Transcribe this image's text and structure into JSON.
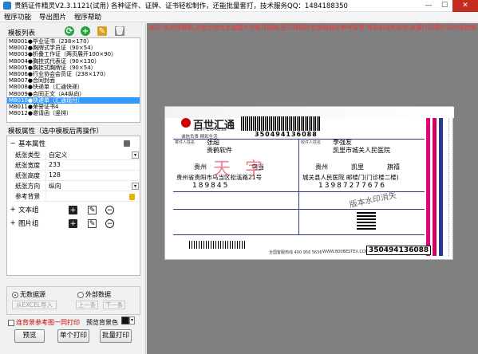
{
  "window": {
    "title": "贵鹤证件精灵V2.3.1121(试用)   各种证件、证牌、证书轻松制作，还能批量套打，技术服务QQ：1484188350"
  },
  "menu": [
    "程序功能",
    "导出图片",
    "程序帮助"
  ],
  "left": {
    "template_list_label": "模板列表",
    "templates": [
      "M8001●毕业证书（238×170）",
      "M8002●胸牌式学员证（90×54）",
      "M8003●折叠工作证（两页展开100×90）",
      "M8004●胸挂式代表证（90×130）",
      "M8005●胸挂式胸牌证（90×54）",
      "M8006●行业协会会员证（238×170）",
      "M8007●合同封面",
      "M8008●快递单（汇通快递）",
      "M8009●合同正文（A4纵向）",
      "M8010●快递单（汇通现付）",
      "M8011●荣誉证书4",
      "M8012●邀请函（竖排）"
    ],
    "selected_index": 9,
    "props_label": "模板属性（选中模板后再操作）",
    "groups": {
      "basic": "基本属性",
      "text": "文本组",
      "image": "图片组"
    },
    "props": [
      {
        "k": "纸张类型",
        "v": "自定义",
        "dd": true
      },
      {
        "k": "纸张宽度",
        "v": "233",
        "dd": false
      },
      {
        "k": "纸张高度",
        "v": "128",
        "dd": false
      },
      {
        "k": "纸张方向",
        "v": "纵向",
        "dd": true
      },
      {
        "k": "参考背景",
        "v": "",
        "dd": false
      }
    ],
    "radio_none": "无数据源",
    "radio_ext": "外部数据",
    "btn_excel": "从EXCEL导入",
    "btn_prev": "上一条",
    "btn_next": "下一条",
    "chk_bg": "连背景参考图一同打印",
    "preview_bg": "预览背景色",
    "btn_preview": "预览",
    "btn_single": "单个打印",
    "btn_batch": "批量打印"
  },
  "right": {
    "notice": "提示:先选择模板,双击左侧文本或图片对象可编辑,还可将图片直接拖放至参考背景.预览前请先核对,批量打印需打开外部数据."
  },
  "ticket": {
    "brand_cn": "百世汇通",
    "brand_en": "BEST EXPRESS",
    "slogan": "诚信负责·精彩生活",
    "tracking": "350494136088",
    "sender_label": "寄件人姓名",
    "sender_name": "张超",
    "sender_city": "贵州",
    "sender_district": "乌当",
    "sender_company": "贵鹤软件",
    "sender_address": "贵州省贵阳市乌当区松溪路21号",
    "sender_phone": "189845",
    "recipient_label": "收件人姓名",
    "recipient_name": "李强友",
    "recipient_city": "贵州",
    "recipient_district": "凯里",
    "recipient_area": "旗禧",
    "recipient_company": "凯里市城关人民医院",
    "recipient_address": "城关县人民医院 邮楼门(门诊楼二楼)",
    "recipient_phone": "13987277676",
    "watermark_a": "天字",
    "watermark_b": "版本水印消失",
    "hotline": "全国客服热线 400 956 5656",
    "site": "WWW.800BESTEX.COM",
    "bottom_tracking": "350494136088"
  }
}
